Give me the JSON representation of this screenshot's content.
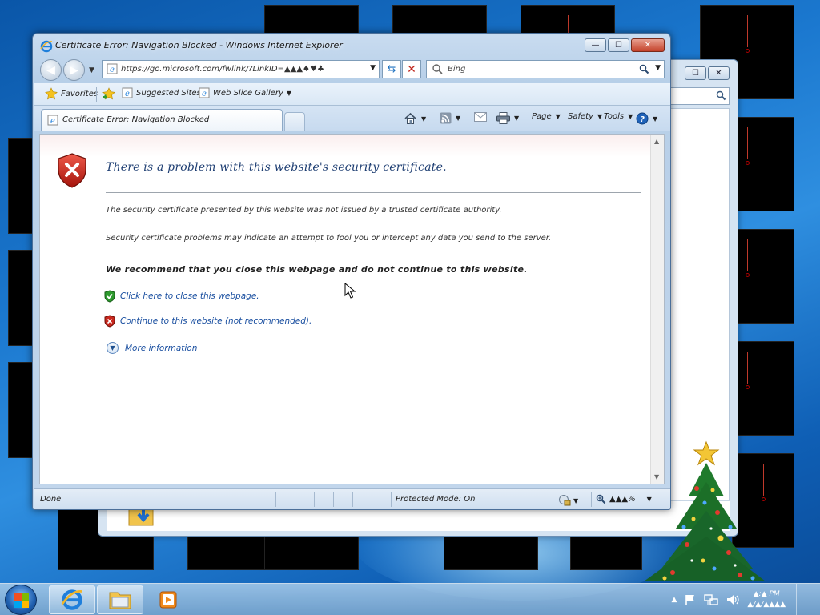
{
  "window": {
    "title": "Certificate Error: Navigation Blocked - Windows Internet Explorer",
    "minimize_label": "—",
    "maximize_label": "☐",
    "close_label": "✕"
  },
  "address_bar": {
    "url": "https://go.microsoft.com/fwlink/?LinkID=▲▲▲♠♥♣",
    "refresh_label": "⇆",
    "stop_label": "✕"
  },
  "search_box": {
    "placeholder": "Bing"
  },
  "favorites_bar": {
    "favorites_label": "Favorites",
    "items": [
      {
        "label": "Suggested Sites"
      },
      {
        "label": "Web Slice Gallery"
      }
    ]
  },
  "tab": {
    "label": "Certificate Error: Navigation Blocked"
  },
  "command_bar": {
    "page_label": "Page",
    "safety_label": "Safety",
    "tools_label": "Tools"
  },
  "content": {
    "heading": "There is a problem with this website's security certificate.",
    "paragraph_1": "The security certificate presented by this website was not issued by a trusted certificate authority.",
    "paragraph_2": "Security certificate problems may indicate an attempt to fool you or intercept any data you send to the server.",
    "recommendation": "We recommend that you close this webpage and do not continue to this website.",
    "close_link": "Click here to close this webpage.",
    "continue_link": "Continue to this website (not recommended).",
    "more_info": "More information"
  },
  "status_bar": {
    "status": "Done",
    "protected_mode": "Protected Mode: On",
    "zoom": "▲▲▲%"
  },
  "taskbar": {
    "time": "▲:▲ PM",
    "date": "▲/▲/▲▲▲▲"
  },
  "colors": {
    "link": "#1a4fa0",
    "heading": "#1f3f73",
    "error_red": "#c8281e",
    "safe_green": "#2e9a2e",
    "desktop_blue": "#1b78cf"
  },
  "icons": {
    "window": "ie-icon",
    "error": "red-shield-x-icon",
    "close_link": "green-shield-check-icon",
    "continue_link": "red-shield-x-icon",
    "more_info": "chevron-down-circle-icon"
  }
}
